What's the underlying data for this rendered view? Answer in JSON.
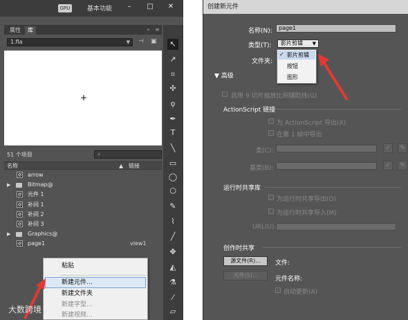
{
  "topbar": {
    "gpu_label": "GPU",
    "workspace": "基本功能",
    "min": "–",
    "max": "□",
    "close": "✕"
  },
  "panel": {
    "tabs": [
      "属性",
      "库"
    ],
    "file": "1.fla",
    "item_count": "51 个项目",
    "col_name": "名称",
    "col_link": "链接",
    "items": [
      {
        "label": "arrow",
        "kind": "symbol",
        "link": ""
      },
      {
        "label": "Bitmap@",
        "kind": "folder",
        "link": ""
      },
      {
        "label": "元件 1",
        "kind": "symbol",
        "link": ""
      },
      {
        "label": "补间 1",
        "kind": "symbol",
        "link": ""
      },
      {
        "label": "补间 2",
        "kind": "symbol",
        "link": ""
      },
      {
        "label": "补间 3",
        "kind": "symbol",
        "link": ""
      },
      {
        "label": "Graphics@",
        "kind": "folder",
        "link": ""
      },
      {
        "label": "page1",
        "kind": "symbol",
        "link": "view1"
      }
    ]
  },
  "context_menu": {
    "items": [
      "粘贴",
      "新建元件...",
      "新建文件夹",
      "新建字型...",
      "新建视频..."
    ]
  },
  "watermark": "大数跨境",
  "dialog": {
    "title": "创建新元件",
    "name_label": "名称(N):",
    "name_value": "page1",
    "type_label": "类型(T):",
    "type_value": "影片剪辑",
    "folder_label": "文件夹:",
    "type_options": [
      "影片剪辑",
      "按钮",
      "图形"
    ],
    "advanced": "高级",
    "scale9": "启用 9 切片缩放比例辅助线(G)",
    "as_linkage": "ActionScript 链接",
    "export_as": "为 ActionScript 导出(X)",
    "export_frame1": "在第 1 帧中导出",
    "class_label": "类(C):",
    "base_label": "基类(B):",
    "runtime_shared": "运行时共享库",
    "export_runtime": "为运行时共享导出(O)",
    "import_runtime": "为运行时共享导入(M)",
    "url_label": "URL(U):",
    "authortime_shared": "创作时共享",
    "source_file_btn": "源文件(R)...",
    "file_label": "文件:",
    "symbol_btn": "元件(S)...",
    "symbol_name_label": "元件名称:",
    "auto_update": "自动更新(A)"
  }
}
